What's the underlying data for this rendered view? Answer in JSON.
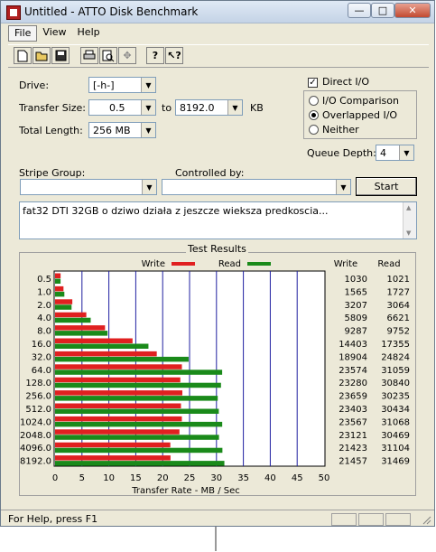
{
  "window": {
    "title": "Untitled - ATTO Disk Benchmark"
  },
  "menu": [
    "File",
    "View",
    "Help"
  ],
  "form": {
    "drive_label": "Drive:",
    "drive_value": "[-h-]",
    "transfer_size_label": "Transfer Size:",
    "transfer_from": "0.5",
    "to_label": "to",
    "transfer_to": "8192.0",
    "kb_label": "KB",
    "total_length_label": "Total Length:",
    "total_length_value": "256 MB",
    "stripe_group_label": "Stripe Group:",
    "controlled_by_label": "Controlled by:",
    "start_label": "Start",
    "description": "fat32 DTI 32GB o dziwo działa z jeszcze wieksza predkoscia..."
  },
  "options": {
    "direct_io": {
      "label": "Direct I/O",
      "checked": true
    },
    "io_comparison": "I/O Comparison",
    "overlapped_io": "Overlapped I/O",
    "neither": "Neither",
    "queue_depth_label": "Queue Depth:",
    "queue_depth_value": "4"
  },
  "results": {
    "title": "Test Results",
    "legend_write": "Write",
    "legend_read": "Read",
    "col_write": "Write",
    "col_read": "Read",
    "xlabel": "Transfer Rate - MB / Sec",
    "colors": {
      "write": "#e02020",
      "read": "#1a8a1a",
      "grid": "#1f1fa0"
    }
  },
  "chart_data": {
    "type": "bar",
    "categories": [
      "0.5",
      "1.0",
      "2.0",
      "4.0",
      "8.0",
      "16.0",
      "32.0",
      "64.0",
      "128.0",
      "256.0",
      "512.0",
      "1024.0",
      "2048.0",
      "4096.0",
      "8192.0"
    ],
    "series": [
      {
        "name": "Write",
        "values": [
          1030,
          1565,
          3207,
          5809,
          9287,
          14403,
          18904,
          23574,
          23280,
          23659,
          23403,
          23567,
          23121,
          21423,
          21457
        ]
      },
      {
        "name": "Read",
        "values": [
          1021,
          1727,
          3064,
          6621,
          9752,
          17355,
          24824,
          31059,
          30840,
          30235,
          30434,
          31068,
          30469,
          31104,
          31469
        ]
      }
    ],
    "xlabel": "Transfer Rate - MB / Sec",
    "xlim": [
      0,
      50
    ],
    "xticks": [
      0,
      5,
      10,
      15,
      20,
      25,
      30,
      35,
      40,
      45,
      50
    ],
    "grid": true,
    "legend": "top"
  },
  "status": {
    "text": "For Help, press F1"
  }
}
